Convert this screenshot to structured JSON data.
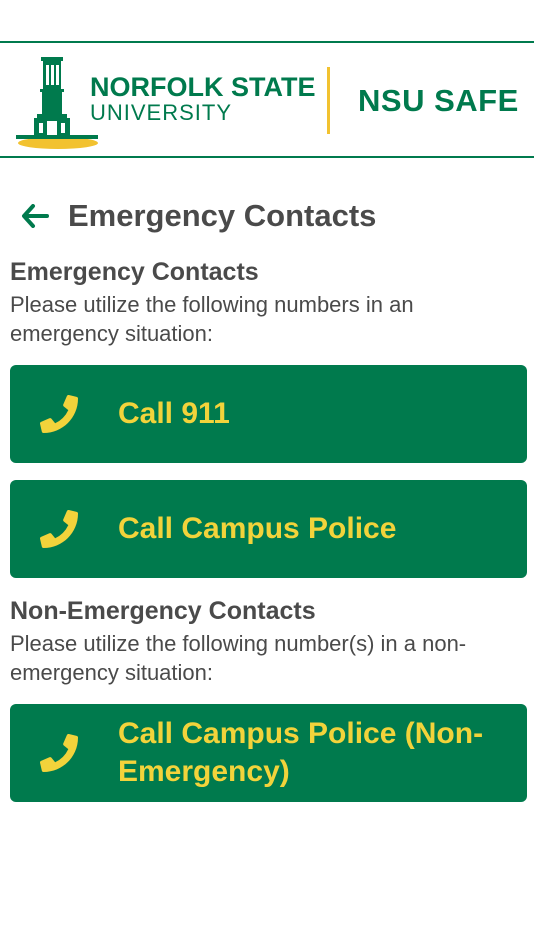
{
  "header": {
    "university_line1": "NORFOLK STATE",
    "university_line2": "UNIVERSITY",
    "app_name": "NSU SAFE"
  },
  "page": {
    "title": "Emergency Contacts"
  },
  "emergency": {
    "heading": "Emergency Contacts",
    "description": "Please utilize the following numbers in an emergency situation:",
    "buttons": [
      {
        "label": "Call 911"
      },
      {
        "label": "Call Campus Police"
      }
    ]
  },
  "non_emergency": {
    "heading": "Non-Emergency Contacts",
    "description": "Please utilize the following number(s) in a non-emergency situation:",
    "buttons": [
      {
        "label": "Call Campus Police (Non-Emergency)"
      }
    ]
  },
  "colors": {
    "brand_green": "#007a4d",
    "brand_gold": "#f2c230",
    "button_text": "#f2d33b",
    "text_gray": "#4a4a4a"
  },
  "icons": {
    "back": "arrow-left-icon",
    "phone": "phone-icon",
    "logo": "bell-tower-logo-icon"
  }
}
